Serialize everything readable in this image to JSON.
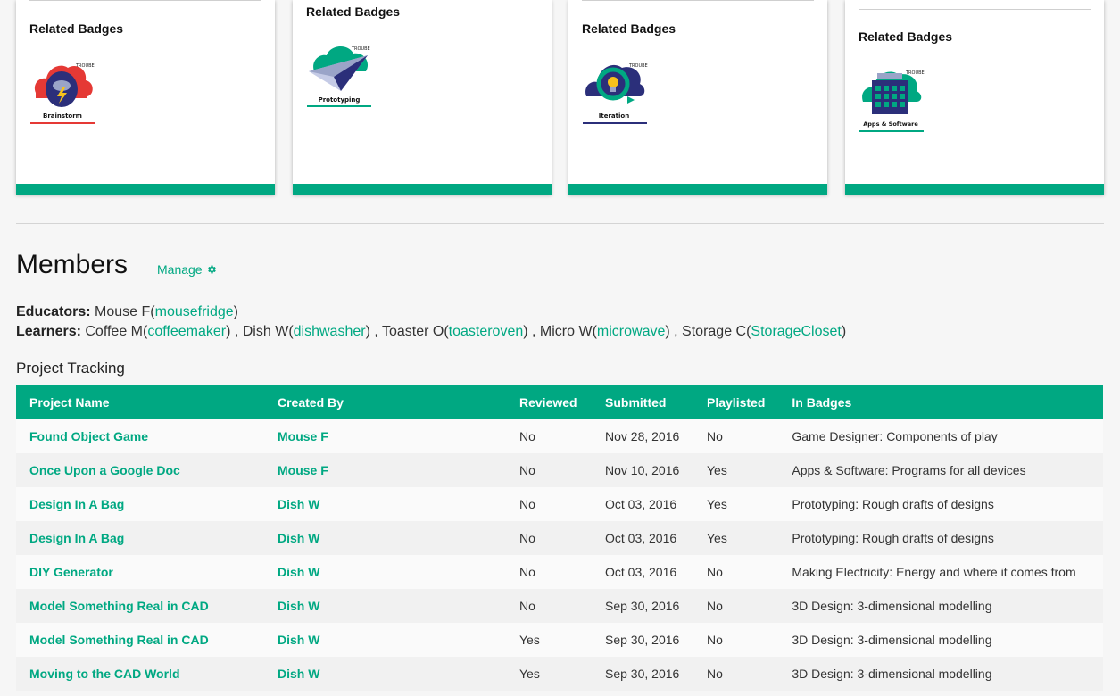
{
  "colors": {
    "accent": "#00a882",
    "header_text": "#ffffff"
  },
  "cards": [
    {
      "heading": "Related Badges",
      "badge": {
        "name": "Brainstorm",
        "org": "TROUBE",
        "icon": "storm-cloud-icon",
        "color": "#e53935"
      }
    },
    {
      "heading": "Related Badges",
      "badge": {
        "name": "Prototyping",
        "org": "TROUBE",
        "icon": "paper-plane-icon",
        "color": "#00a882"
      }
    },
    {
      "heading": "Related Badges",
      "badge": {
        "name": "Iteration",
        "org": "TROUBE",
        "icon": "lightbulb-cycle-icon",
        "color": "#2b2f7a"
      }
    },
    {
      "heading": "Related Badges",
      "badge": {
        "name": "Apps & Software",
        "org": "TROUBE",
        "icon": "app-grid-icon",
        "color": "#00a882"
      }
    }
  ],
  "members": {
    "title": "Members",
    "manage_label": "Manage",
    "educators_label": "Educators:",
    "learners_label": "Learners:",
    "educators": [
      {
        "name": "Mouse F",
        "username": "mousefridge"
      }
    ],
    "learners": [
      {
        "name": "Coffee M",
        "username": "coffeemaker"
      },
      {
        "name": "Dish W",
        "username": "dishwasher"
      },
      {
        "name": "Toaster O",
        "username": "toasteroven"
      },
      {
        "name": "Micro W",
        "username": "microwave"
      },
      {
        "name": "Storage C",
        "username": "StorageCloset"
      }
    ]
  },
  "tracking": {
    "title": "Project Tracking",
    "columns": [
      "Project Name",
      "Created By",
      "Reviewed",
      "Submitted",
      "Playlisted",
      "In Badges"
    ],
    "rows": [
      [
        "Found Object Game",
        "Mouse F",
        "No",
        "Nov 28, 2016",
        "No",
        "Game Designer: Components of play"
      ],
      [
        "Once Upon a Google Doc",
        "Mouse F",
        "No",
        "Nov 10, 2016",
        "Yes",
        "Apps & Software: Programs for all devices"
      ],
      [
        "Design In A Bag",
        "Dish W",
        "No",
        "Oct 03, 2016",
        "Yes",
        "Prototyping: Rough drafts of designs"
      ],
      [
        "Design In A Bag",
        "Dish W",
        "No",
        "Oct 03, 2016",
        "Yes",
        "Prototyping: Rough drafts of designs"
      ],
      [
        "DIY Generator",
        "Dish W",
        "No",
        "Oct 03, 2016",
        "No",
        "Making Electricity: Energy and where it comes from"
      ],
      [
        "Model Something Real in CAD",
        "Dish W",
        "No",
        "Sep 30, 2016",
        "No",
        "3D Design: 3-dimensional modelling"
      ],
      [
        "Model Something Real in CAD",
        "Dish W",
        "Yes",
        "Sep 30, 2016",
        "No",
        "3D Design: 3-dimensional modelling"
      ],
      [
        "Moving to the CAD World",
        "Dish W",
        "Yes",
        "Sep 30, 2016",
        "No",
        "3D Design: 3-dimensional modelling"
      ]
    ]
  }
}
